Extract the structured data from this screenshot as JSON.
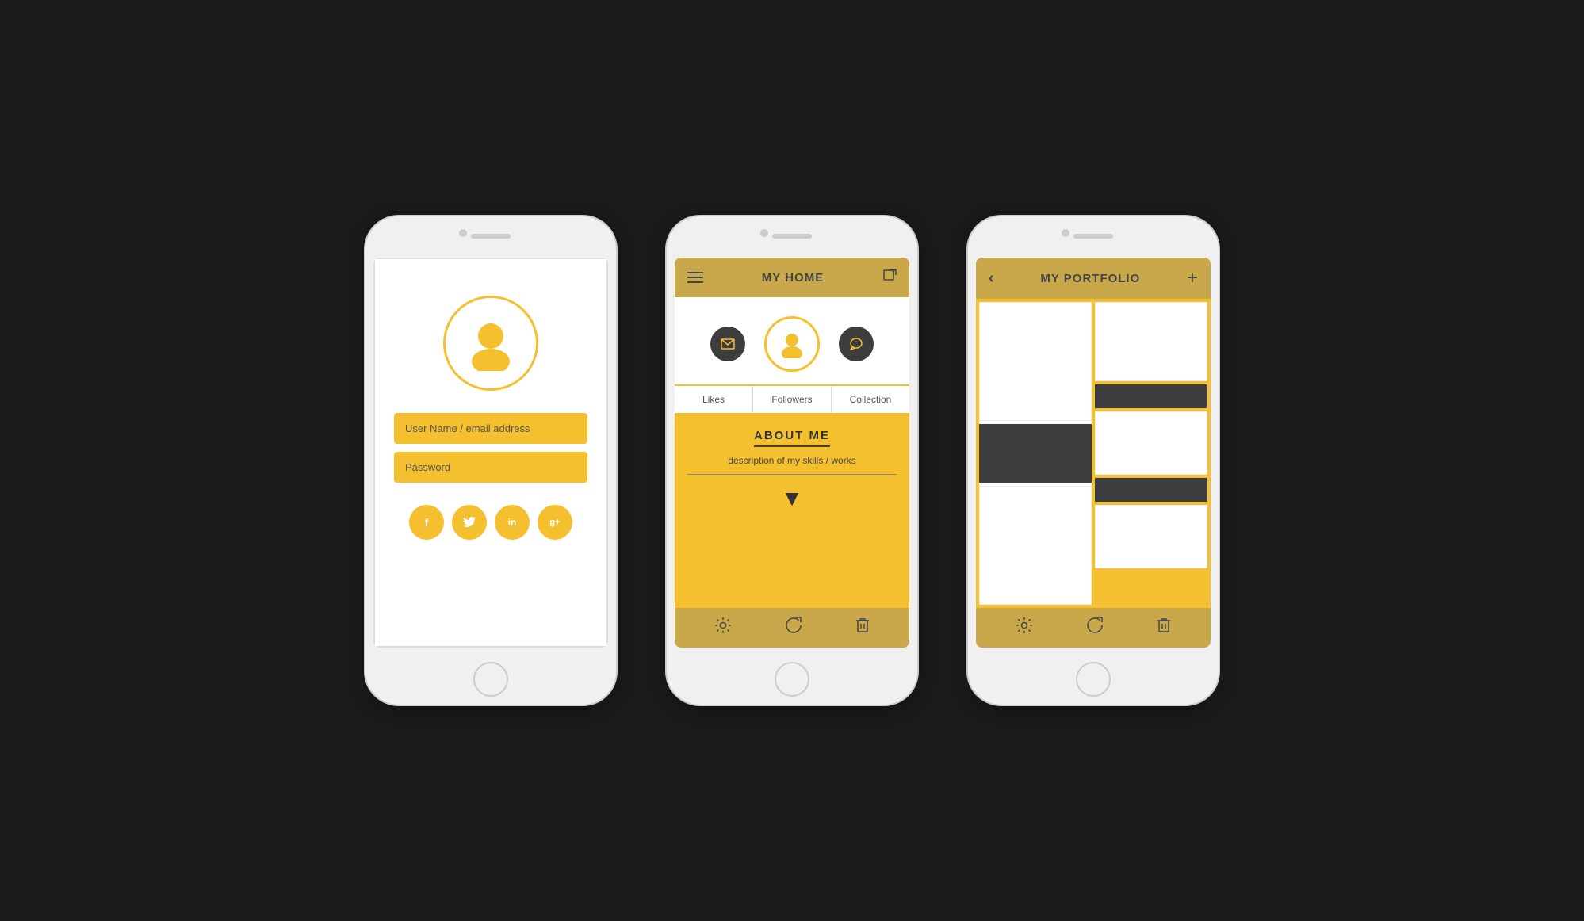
{
  "phone1": {
    "avatar_placeholder": "👤",
    "username_placeholder": "User Name / email address",
    "password_placeholder": "Password",
    "social": [
      {
        "label": "f",
        "name": "facebook"
      },
      {
        "label": "t",
        "name": "twitter"
      },
      {
        "label": "in",
        "name": "linkedin"
      },
      {
        "label": "g+",
        "name": "googleplus"
      }
    ]
  },
  "phone2": {
    "header": {
      "title": "MY HOME"
    },
    "tabs": [
      {
        "label": "Likes"
      },
      {
        "label": "Followers"
      },
      {
        "label": "Collection"
      }
    ],
    "about": {
      "title": "ABOUT ME",
      "description": "description of my skills / works"
    },
    "bottom_icons": [
      "⚙",
      "↻",
      "🗑"
    ]
  },
  "phone3": {
    "header": {
      "title": "MY PORTFOLIO"
    },
    "bottom_icons": [
      "⚙",
      "↻",
      "🗑"
    ]
  }
}
